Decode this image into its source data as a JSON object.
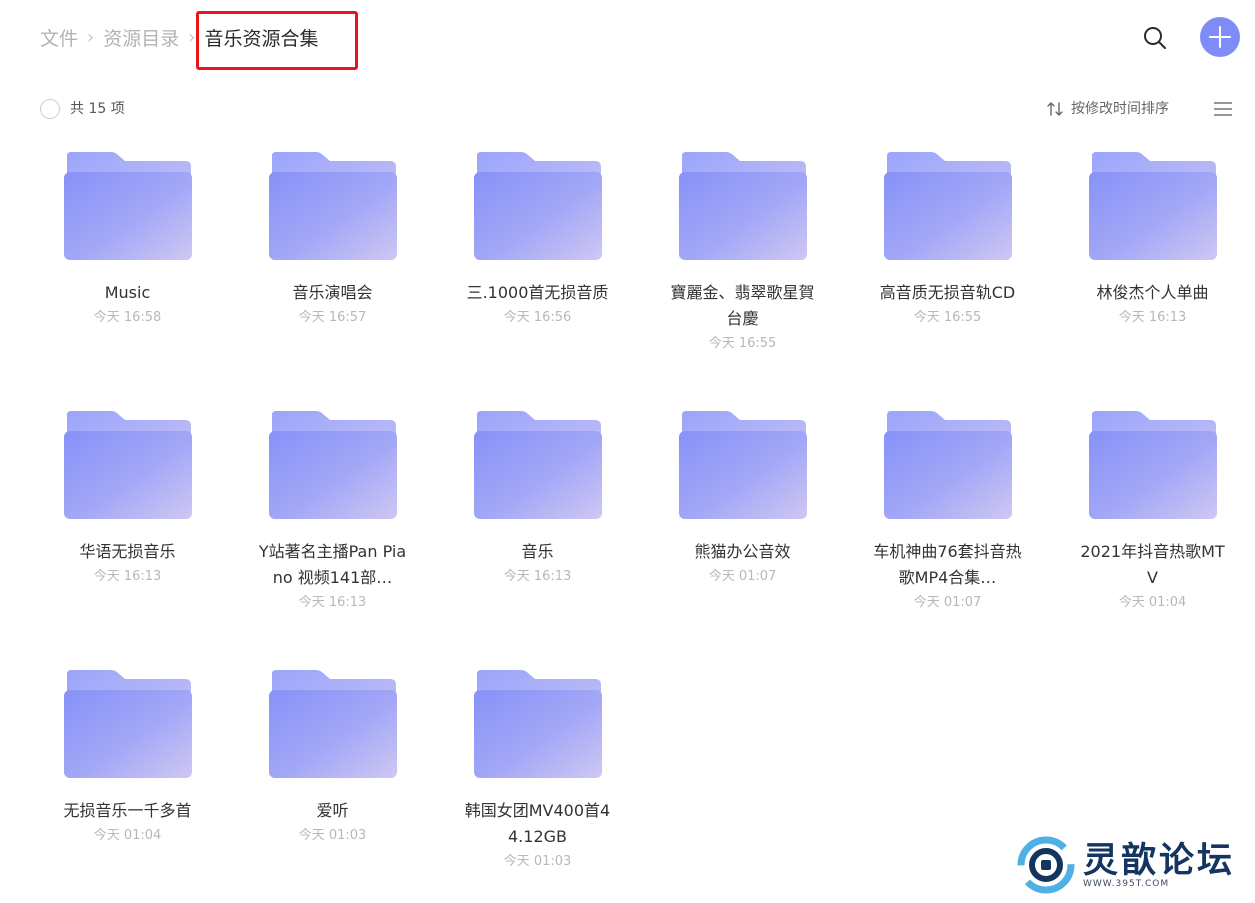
{
  "breadcrumb": {
    "items": [
      "文件",
      "资源目录"
    ],
    "current": "音乐资源合集",
    "separator": "›"
  },
  "toolbar": {
    "count_label": "共 15 项",
    "sort_label": "按修改时间排序"
  },
  "header": {
    "search_icon": "search-icon",
    "add_icon": "plus-icon",
    "accent_color": "#7f8cf7"
  },
  "folders": [
    {
      "name": "Music",
      "time": "今天 16:58"
    },
    {
      "name": "音乐演唱会",
      "time": "今天 16:57"
    },
    {
      "name": "三.1000首无损音质",
      "time": "今天 16:56"
    },
    {
      "name": "寶麗金、翡翠歌星賀台慶",
      "time": "今天 16:55"
    },
    {
      "name": "高音质无损音轨CD",
      "time": "今天 16:55"
    },
    {
      "name": "林俊杰个人单曲",
      "time": "今天 16:13"
    },
    {
      "name": "华语无损音乐",
      "time": "今天 16:13"
    },
    {
      "name": "Y站著名主播Pan Piano 视频141部…",
      "time": "今天 16:13"
    },
    {
      "name": "音乐",
      "time": "今天 16:13"
    },
    {
      "name": "熊猫办公音效",
      "time": "今天 01:07"
    },
    {
      "name": "车机神曲76套抖音热歌MP4合集…",
      "time": "今天 01:07"
    },
    {
      "name": "2021年抖音热歌MTV",
      "time": "今天 01:04"
    },
    {
      "name": "无损音乐一千多首",
      "time": "今天 01:04"
    },
    {
      "name": "爱听",
      "time": "今天 01:03"
    },
    {
      "name": "韩国女团MV400首44.12GB",
      "time": "今天 01:03"
    }
  ],
  "watermark": {
    "text": "灵歆论坛",
    "url": "WWW.395T.COM"
  }
}
